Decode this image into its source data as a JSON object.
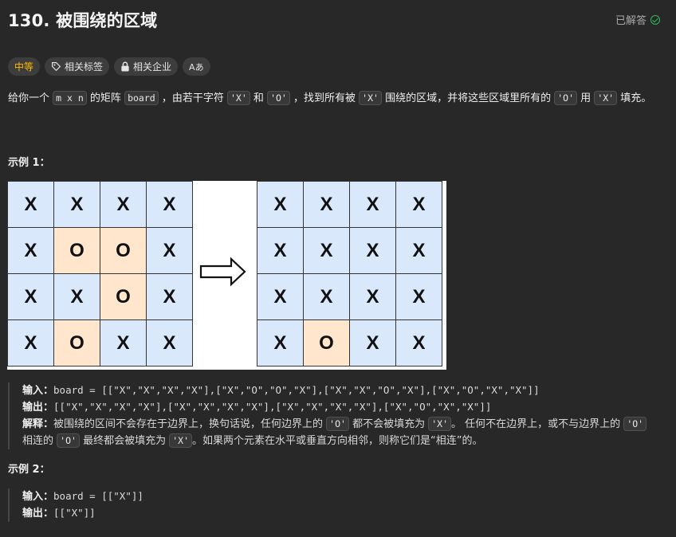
{
  "problem": {
    "title": "130. 被围绕的区域",
    "solved_label": "已解答"
  },
  "tags": {
    "difficulty": "中等",
    "related_tags": "相关标签",
    "related_companies": "相关企业",
    "font_label": "Aあ"
  },
  "description": {
    "p1": "给你一个",
    "c1": "m x n",
    "p2": "的矩阵",
    "c2": "board",
    "p3": "，由若干字符",
    "c3": "'X'",
    "p4": "和",
    "c4": "'O'",
    "p5": "，找到所有被",
    "c5": "'X'",
    "p6": "围绕的区域，并将这些区域里所有的",
    "c6": "'O'",
    "p7": "用",
    "c7": "'X'",
    "p8": "填充。"
  },
  "example1": {
    "title": "示例 1：",
    "input_label": "输入：",
    "input_value": "board = [[\"X\",\"X\",\"X\",\"X\"],[\"X\",\"O\",\"O\",\"X\"],[\"X\",\"X\",\"O\",\"X\"],[\"X\",\"O\",\"X\",\"X\"]]",
    "output_label": "输出：",
    "output_value": "[[\"X\",\"X\",\"X\",\"X\"],[\"X\",\"X\",\"X\",\"X\"],[\"X\",\"X\",\"X\",\"X\"],[\"X\",\"O\",\"X\",\"X\"]]",
    "explain_label": "解释：",
    "e1": "被围绕的区间不会存在于边界上，换句话说，任何边界上的",
    "ec1": "'O'",
    "e2": "都不会被填充为",
    "ec2": "'X'",
    "e3": "。 任何不在边界上，或不与边界上的",
    "ec3": "'O'",
    "e4": "相连的",
    "ec4": "'O'",
    "e5": "最终都会被填充为",
    "ec5": "'X'",
    "e6": "。如果两个元素在水平或垂直方向相邻，则称它们是“相连”的。",
    "grid_before": [
      [
        "X",
        "X",
        "X",
        "X"
      ],
      [
        "X",
        "O",
        "O",
        "X"
      ],
      [
        "X",
        "X",
        "O",
        "X"
      ],
      [
        "X",
        "O",
        "X",
        "X"
      ]
    ],
    "grid_after": [
      [
        "X",
        "X",
        "X",
        "X"
      ],
      [
        "X",
        "X",
        "X",
        "X"
      ],
      [
        "X",
        "X",
        "X",
        "X"
      ],
      [
        "X",
        "O",
        "X",
        "X"
      ]
    ]
  },
  "example2": {
    "title": "示例 2：",
    "input_label": "输入：",
    "input_value": "board = [[\"X\"]]",
    "output_label": "输出：",
    "output_value": "[[\"X\"]]"
  },
  "colors": {
    "difficulty_medium": "#ffb800",
    "solved_green": "#2cbb5d",
    "cell_x": "#dae8fc",
    "cell_o": "#ffe6cc"
  }
}
